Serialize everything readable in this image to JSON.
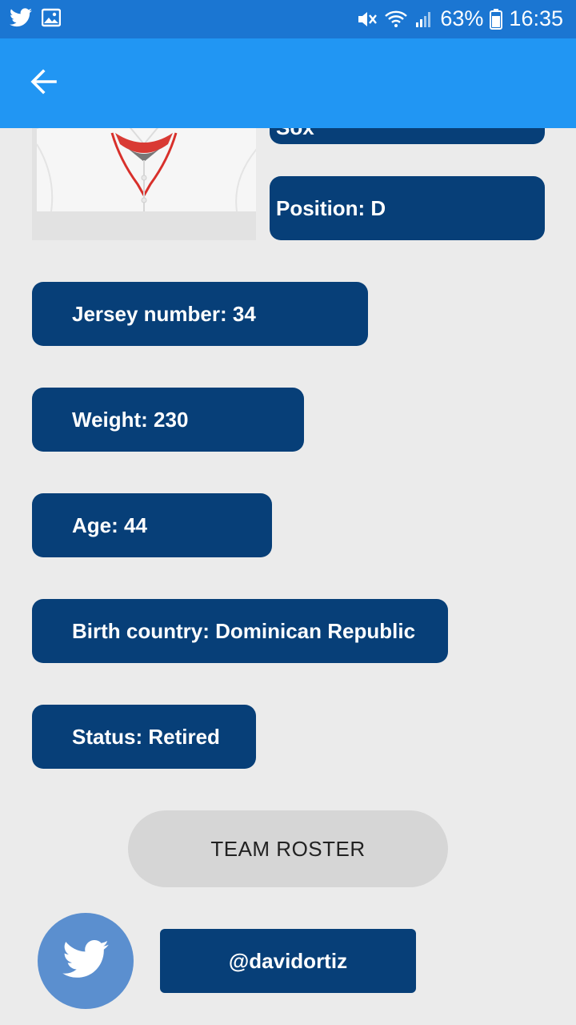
{
  "status_bar": {
    "battery": "63%",
    "time": "16:35",
    "left_icons": [
      "twitter-icon",
      "image-icon"
    ],
    "right_icons": [
      "mute-icon",
      "wifi-icon",
      "signal-icon",
      "battery-icon"
    ]
  },
  "app_bar": {
    "back_icon": "arrow-back-icon"
  },
  "player": {
    "partial_label": "Sox",
    "position": "Position: D",
    "jersey": "Jersey number: 34",
    "weight": "Weight: 230",
    "age": "Age: 44",
    "birth_country": "Birth country: Dominican Republic",
    "status": "Status: Retired"
  },
  "actions": {
    "team_roster": "TEAM ROSTER",
    "twitter_handle": "@davidortiz",
    "twitter_icon": "twitter-icon"
  },
  "colors": {
    "status_bar": "#1b76d2",
    "app_bar": "#2196f3",
    "pill": "#073f78",
    "background": "#ebebeb",
    "roster_button": "#d6d6d6",
    "twitter_fab": "#5b8fcf"
  }
}
